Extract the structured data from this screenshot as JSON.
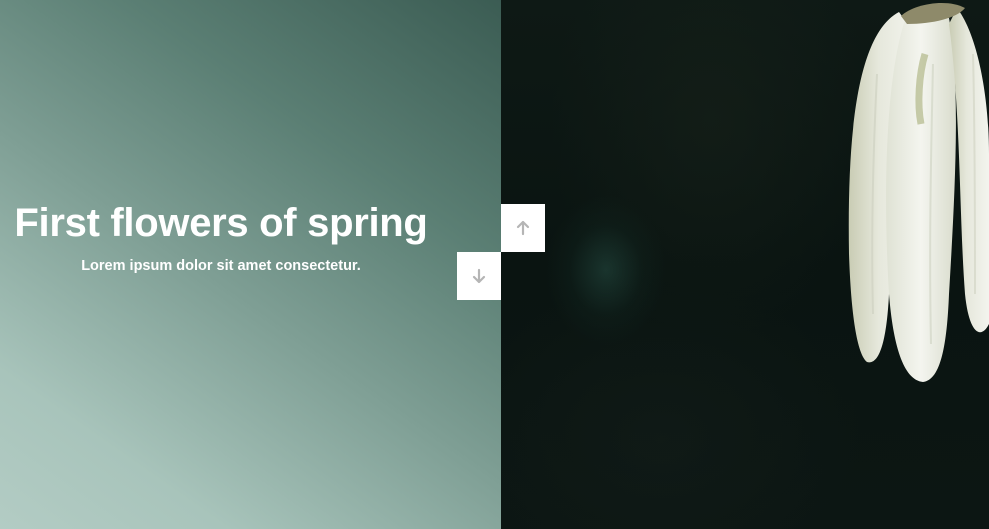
{
  "slide": {
    "title": "First flowers of spring",
    "subtitle": "Lorem ipsum dolor sit amet consectetur."
  },
  "controls": {
    "up_icon": "arrow-up-icon",
    "down_icon": "arrow-down-icon"
  },
  "colors": {
    "panel_gradient_light": "#b3ccc4",
    "panel_gradient_dark": "#3b5c53",
    "photo_background": "#0a1411",
    "text": "#ffffff",
    "button_background": "#ffffff",
    "button_icon": "#b5b5b5"
  }
}
